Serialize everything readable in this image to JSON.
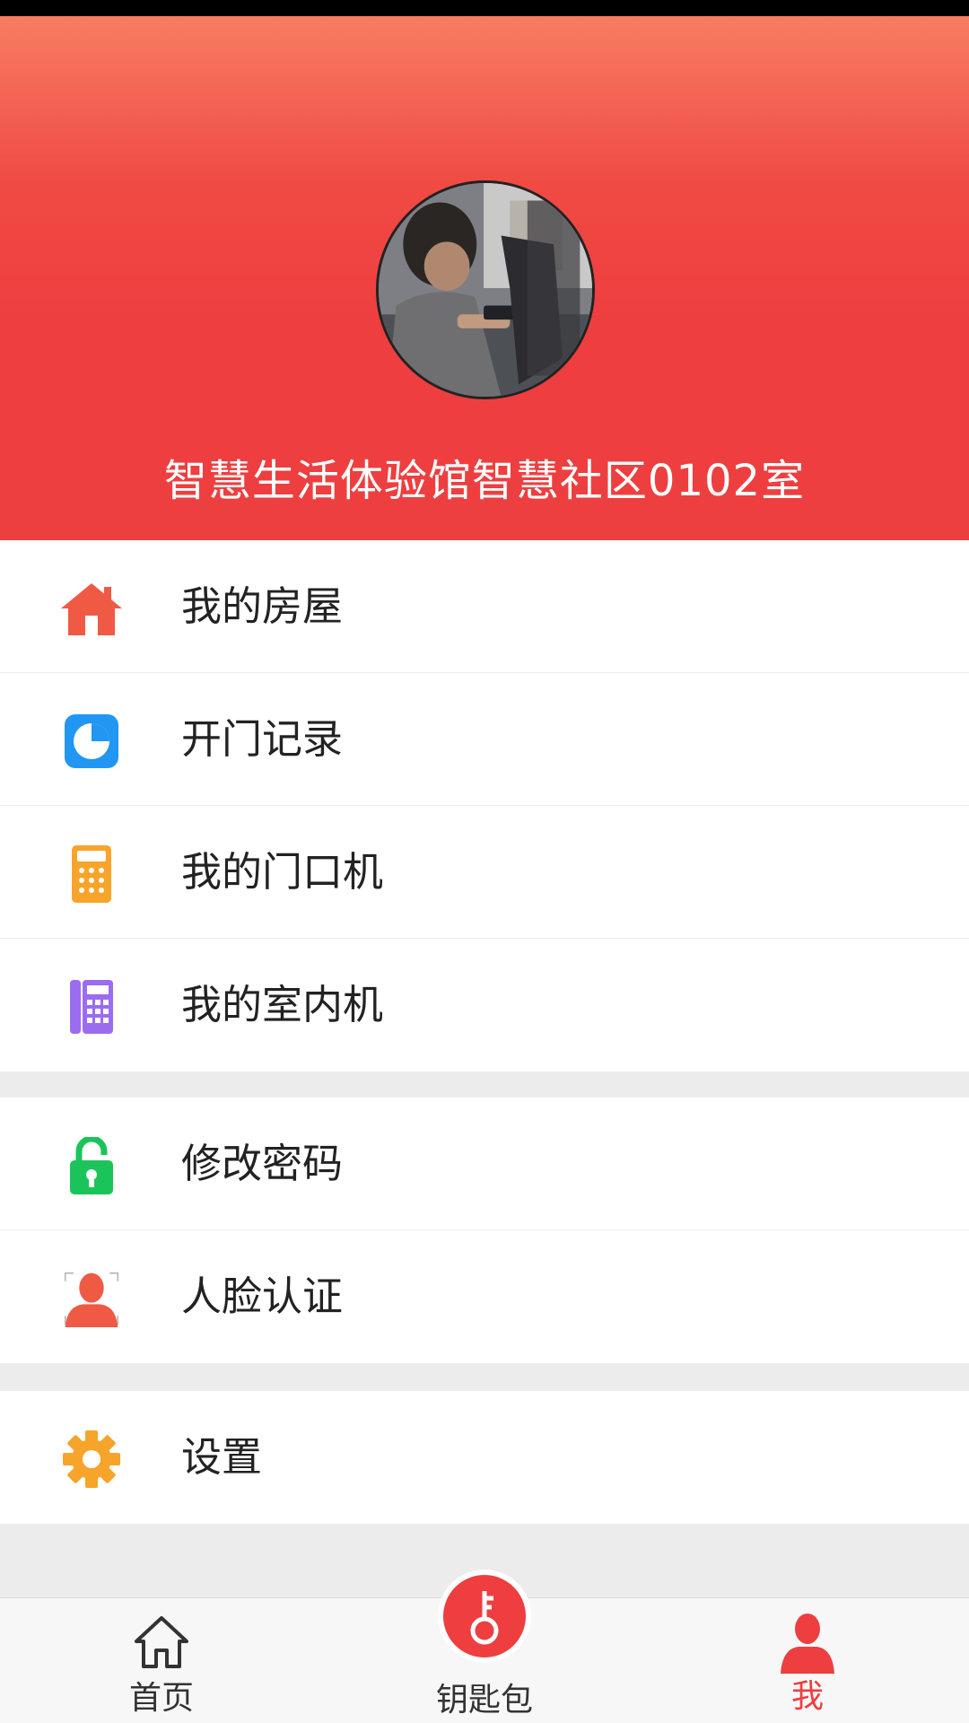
{
  "header": {
    "room_name": "智慧生活体验馆智慧社区0102室"
  },
  "menu": {
    "group1": [
      {
        "label": "我的房屋",
        "icon": "house-icon",
        "color": "#f05a45"
      },
      {
        "label": "开门记录",
        "icon": "pie-chart-icon",
        "color": "#2196f3"
      },
      {
        "label": "我的门口机",
        "icon": "keypad-icon",
        "color": "#f7a42a"
      },
      {
        "label": "我的室内机",
        "icon": "intercom-icon",
        "color": "#9b6cf0"
      }
    ],
    "group2": [
      {
        "label": "修改密码",
        "icon": "unlock-icon",
        "color": "#1bc45a"
      },
      {
        "label": "人脸认证",
        "icon": "face-id-icon",
        "color": "#f05a45"
      }
    ],
    "group3": [
      {
        "label": "设置",
        "icon": "gear-icon",
        "color": "#f7a42a"
      }
    ]
  },
  "bottom_nav": {
    "home": "首页",
    "keys": "钥匙包",
    "me": "我",
    "active_color": "#ee3e3f"
  }
}
